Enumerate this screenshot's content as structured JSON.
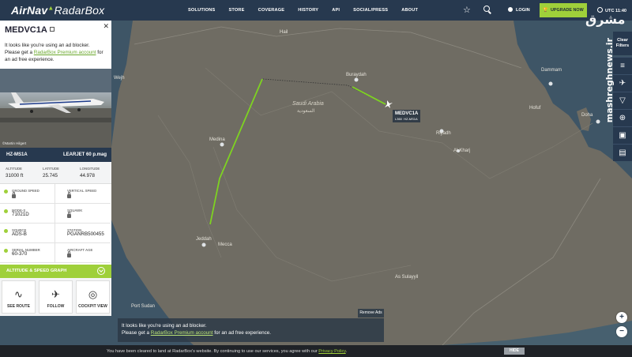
{
  "header": {
    "logo_main": "AirNav",
    "logo_sub": "RadarBox",
    "nav": [
      "SOLUTIONS",
      "STORE",
      "COVERAGE",
      "HISTORY",
      "API",
      "SOCIAL/PRESS",
      "ABOUT"
    ],
    "login": "LOGIN",
    "upgrade": "UPGRADE NOW",
    "utc": "UTC 11:40"
  },
  "panel": {
    "callsign": "MEDVC1A",
    "ad_line1": "It looks like you're using an ad blocker.",
    "ad_line2_pre": "Please get a ",
    "ad_link": "RadarBox Premium account",
    "ad_line2_post": " for an ad free experience.",
    "photo_credit": "©Martin Hilgert",
    "registration": "HZ-MS1A",
    "aircraft_type": "LEARJET 60 p.mag",
    "altitude_label": "ALTITUDE",
    "altitude": "31000 ft",
    "latitude_label": "LATITUDE",
    "latitude": "25.745",
    "longitude_label": "LONGITUDE",
    "longitude": "44.978",
    "ground_speed_label": "GROUND SPEED",
    "vertical_speed_label": "VERTICAL SPEED",
    "mode_s_label": "MODE-S",
    "mode_s": "71021D",
    "squawk_label": "SQUAWK",
    "source_label": "SOURCE",
    "source": "ADS-B",
    "station_label": "STATION",
    "station": "PGANRB500455",
    "serial_label": "SERIAL NUMBER",
    "serial": "60-370",
    "aircraft_age_label": "AIRCRAFT AGE",
    "alt_speed_graph": "ALTITUDE & SPEED GRAPH",
    "actions": [
      "SEE ROUTE",
      "FOLLOW",
      "COCKPIT VIEW"
    ]
  },
  "map": {
    "labels": {
      "hail": "Hail",
      "wejh": "Wejh",
      "buraydah": "Buraydah",
      "saudi_arabia": "Saudi Arabia",
      "saudi_arabia_ar": "السعودية",
      "medina": "Medina",
      "riyadh": "Riyadh",
      "al_kharj": "Al-Kharj",
      "jeddah": "Jeddah",
      "mecca": "Mecca",
      "as_sulayyil": "As Sulayyil",
      "port_sudan": "Port Sudan",
      "dammam": "Dammam",
      "hofuf": "Hofuf",
      "doha": "Doha"
    },
    "plane_callsign": "MEDVC1A",
    "plane_sub1": "L360",
    "plane_sub2": "HZ-MS1A"
  },
  "right_tools": {
    "filters": "Clear\nFilters",
    "zoom_in": "+",
    "zoom_out": "−"
  },
  "ad_banner": {
    "line1": "It looks like you're using an ad blocker.",
    "line2_pre": "Please get a ",
    "link": "RadarBox Premium account",
    "line2_post": " for an ad free experience.",
    "remove_ads": "Remove Ads"
  },
  "cookie": {
    "text": "You have been cleared to land at RadarBox's website. By continuing to use our services, you agree with our ",
    "link": "Privacy Policy",
    "hide": "HIDE"
  },
  "watermark": {
    "fa": "مشرق",
    "url": "mashreghnews.ir"
  },
  "colors": {
    "navy": "#27394f",
    "accent_green": "#9fd03a",
    "flight_path": "#7ed321",
    "sea": "#3e5566"
  }
}
